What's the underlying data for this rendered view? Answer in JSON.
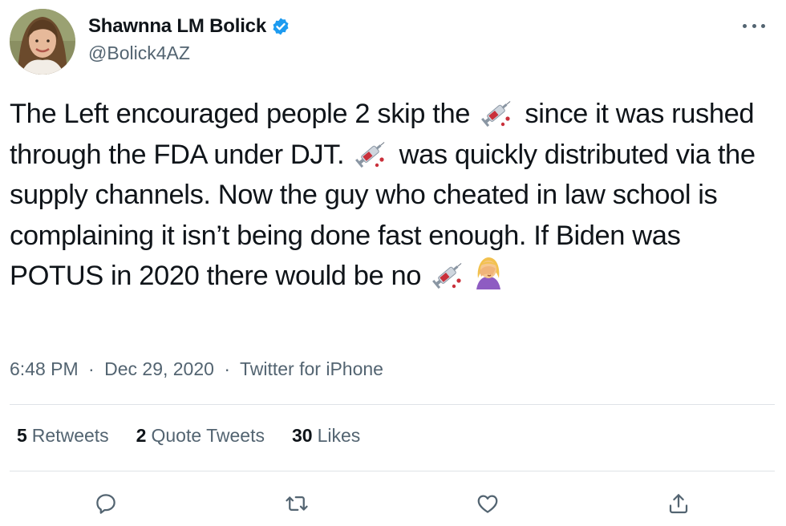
{
  "author": {
    "display_name": "Shawnna LM Bolick",
    "handle": "@Bolick4AZ",
    "verified": true
  },
  "tweet": {
    "segments": [
      "The Left encouraged people 2 skip the",
      "since it was rushed through the FDA under DJT.",
      "was quickly distributed via the supply channels. Now the guy who cheated in law school is complaining it isn’t being done fast enough. If Biden was POTUS in 2020 there would be no"
    ],
    "emoji": [
      "syringe-icon",
      "syringe-icon",
      "syringe-icon",
      "facepalm-icon"
    ]
  },
  "meta": {
    "time": "6:48 PM",
    "separator": "·",
    "date": "Dec 29, 2020",
    "source": "Twitter for iPhone"
  },
  "stats": {
    "retweets": {
      "count": "5",
      "label": "Retweets"
    },
    "quotes": {
      "count": "2",
      "label": "Quote Tweets"
    },
    "likes": {
      "count": "30",
      "label": "Likes"
    }
  },
  "actions": [
    "reply-icon",
    "retweet-icon",
    "like-icon",
    "share-icon"
  ],
  "colors": {
    "text": "#0f1419",
    "secondary": "#536471",
    "verified": "#1d9bf0",
    "divider": "#dfe3e7"
  }
}
